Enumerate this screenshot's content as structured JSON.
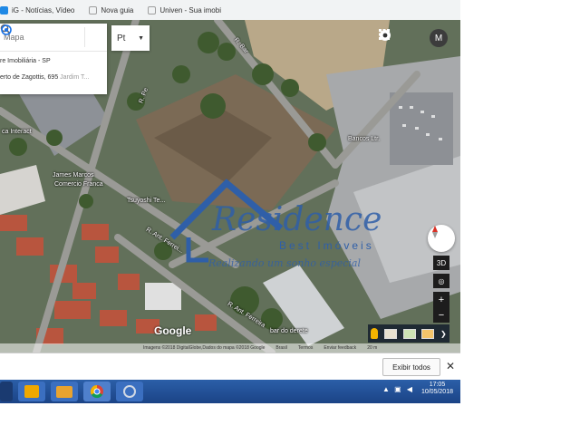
{
  "bookmarks": [
    {
      "label": "iG - Notícias, Vídeo",
      "icon": "ig-icon",
      "color": "#1e88e5"
    },
    {
      "label": "Nova guia",
      "icon": "page-icon",
      "color": "#9e9e9e"
    },
    {
      "label": "Univen - Sua imobi",
      "icon": "page-icon",
      "color": "#9e9e9e"
    }
  ],
  "search": {
    "placeholder": "Mapa",
    "result_line1": "re Imobiliária - SP",
    "result_line2_main": "erto de Zagottis, 695",
    "result_line2_sub": " Jardim T..."
  },
  "language": {
    "selected": "Pt"
  },
  "account": {
    "initial": "M"
  },
  "map_labels": {
    "road_top_left": "R. Pe",
    "road_top": "R. Bar",
    "poi_interact": "ca Interact",
    "poi_james": "James Marcos",
    "poi_james2": "Comercio Franca",
    "poi_tsuyoshi": "Tsuyoshi Te...",
    "poi_bancos": "Bancos Ltr.",
    "road_antonio": "R. Ant. Ferrei...",
    "road_lower": "R. Ant. Ferreira",
    "poi_bar": "bar do derete"
  },
  "controls": {
    "view_3d": "3D",
    "zoom_in": "+",
    "zoom_out": "−"
  },
  "google_logo": "Google",
  "attribution": [
    "Imagens ©2018 DigitalGlobe,Dados do mapa ©2018 Google",
    "Brasil",
    "Termos",
    "Enviar feedback",
    "20 m"
  ],
  "watermark": {
    "brand": "Residence",
    "tagline": "Best Imóveis",
    "slogan": "Realizando um sonho especial",
    "color": "#2f5fa8"
  },
  "download_bar": {
    "show_all": "Exibir todos",
    "close": "✕"
  },
  "taskbar": {
    "apps": [
      "outlook-icon",
      "folder-icon",
      "chrome-icon",
      "settings-icon"
    ],
    "time": "17:05",
    "date": "10/05/2018"
  }
}
